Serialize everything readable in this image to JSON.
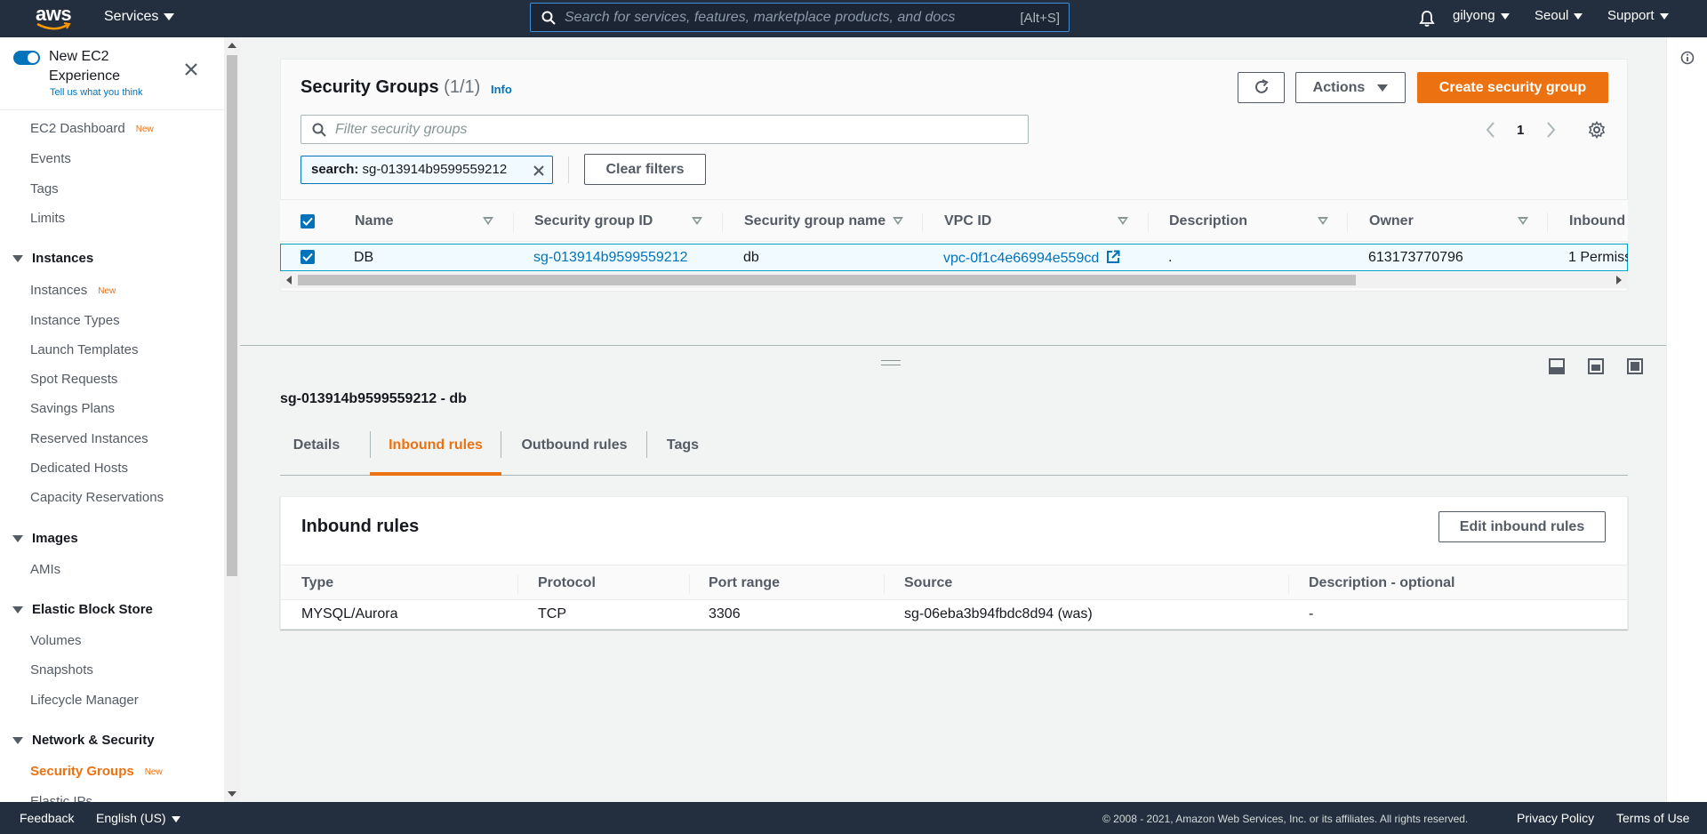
{
  "topnav": {
    "logo_text": "aws",
    "services_label": "Services",
    "search_placeholder": "Search for services, features, marketplace products, and docs",
    "search_shortcut": "[Alt+S]",
    "user_label": "gilyong",
    "region_label": "Seoul",
    "support_label": "Support"
  },
  "sidebar": {
    "experience_title": "New EC2 Experience",
    "experience_link": "Tell us what you think",
    "dashboard": "EC2 Dashboard",
    "new_badge": "New",
    "events": "Events",
    "tags": "Tags",
    "limits": "Limits",
    "sec_instances": "Instances",
    "instances": "Instances",
    "instance_types": "Instance Types",
    "launch_templates": "Launch Templates",
    "spot_requests": "Spot Requests",
    "savings_plans": "Savings Plans",
    "reserved_instances": "Reserved Instances",
    "dedicated_hosts": "Dedicated Hosts",
    "capacity_reservations": "Capacity Reservations",
    "sec_images": "Images",
    "amis": "AMIs",
    "sec_ebs": "Elastic Block Store",
    "volumes": "Volumes",
    "snapshots": "Snapshots",
    "lifecycle_manager": "Lifecycle Manager",
    "sec_network": "Network & Security",
    "security_groups": "Security Groups",
    "elastic_ips_partial": "Elastic IPs"
  },
  "panel": {
    "title": "Security Groups",
    "count": "(1/1)",
    "info": "Info",
    "actions_label": "Actions",
    "create_label": "Create security group",
    "filter_placeholder": "Filter security groups",
    "page": "1",
    "token_key": "search:",
    "token_value": "sg-013914b9599559212",
    "clear_filters": "Clear filters"
  },
  "table": {
    "columns": [
      "Name",
      "Security group ID",
      "Security group name",
      "VPC ID",
      "Description",
      "Owner",
      "Inbound"
    ],
    "row": {
      "name": "DB",
      "sg_id": "sg-013914b9599559212",
      "sg_name": "db",
      "vpc_id": "vpc-0f1c4e66994e559cd",
      "description": ".",
      "owner": "613173770796",
      "inbound": "1 Permiss"
    }
  },
  "detail": {
    "title": "sg-013914b9599559212 - db",
    "tabs": [
      "Details",
      "Inbound rules",
      "Outbound rules",
      "Tags"
    ],
    "active_tab": "Inbound rules"
  },
  "rules": {
    "title": "Inbound rules",
    "edit_label": "Edit inbound rules",
    "columns": [
      "Type",
      "Protocol",
      "Port range",
      "Source",
      "Description - optional"
    ],
    "row": {
      "type": "MYSQL/Aurora",
      "protocol": "TCP",
      "port_range": "3306",
      "source": "sg-06eba3b94fbdc8d94 (was)",
      "description": "-"
    }
  },
  "footer": {
    "feedback": "Feedback",
    "language": "English (US)",
    "copyright": "© 2008 - 2021, Amazon Web Services, Inc. or its affiliates. All rights reserved.",
    "privacy": "Privacy Policy",
    "terms": "Terms of Use"
  },
  "colors": {
    "nav_bg": "#232f3e",
    "accent_orange": "#ec7211",
    "link_blue": "#0073bb"
  },
  "icons": [
    "search-icon",
    "bell-icon",
    "close-icon",
    "refresh-icon",
    "gear-icon",
    "external-link-icon",
    "info-icon",
    "checkbox-icon",
    "split-bottom-icon",
    "split-side-icon",
    "split-full-icon"
  ]
}
